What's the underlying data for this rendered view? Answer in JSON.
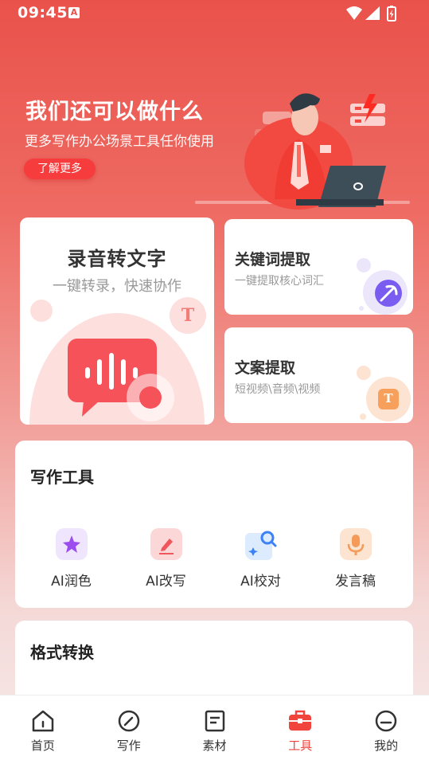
{
  "status_bar": {
    "time": "09:45",
    "app_badge": "A",
    "icons": [
      "wifi-icon",
      "signal-icon",
      "battery-charging-icon"
    ]
  },
  "banner": {
    "title": "我们还可以做什么",
    "subtitle": "更多写作办公场景工具任你使用",
    "button_label": "了解更多"
  },
  "feature_cards": {
    "record": {
      "title": "录音转文字",
      "subtitle": "一键转录，快速协作",
      "badge": "T"
    },
    "keyword": {
      "title": "关键词提取",
      "subtitle": "一键提取核心词汇"
    },
    "copy": {
      "title": "文案提取",
      "subtitle": "短视频\\音频\\视频",
      "badge": "T"
    }
  },
  "writing_tools": {
    "title": "写作工具",
    "items": [
      {
        "label": "AI润色",
        "icon": "sparkle-star-icon"
      },
      {
        "label": "AI改写",
        "icon": "pen-edit-icon"
      },
      {
        "label": "AI校对",
        "icon": "magnifier-check-icon"
      },
      {
        "label": "发言稿",
        "icon": "microphone-icon"
      }
    ]
  },
  "format_conversion": {
    "title": "格式转换"
  },
  "tab_bar": {
    "items": [
      {
        "label": "首页",
        "icon": "home-icon",
        "active": false
      },
      {
        "label": "写作",
        "icon": "compose-icon",
        "active": false
      },
      {
        "label": "素材",
        "icon": "document-icon",
        "active": false
      },
      {
        "label": "工具",
        "icon": "toolbox-icon",
        "active": true
      },
      {
        "label": "我的",
        "icon": "profile-icon",
        "active": false
      }
    ]
  },
  "colors": {
    "accent": "#f0443c",
    "header_red": "#e9524b"
  }
}
